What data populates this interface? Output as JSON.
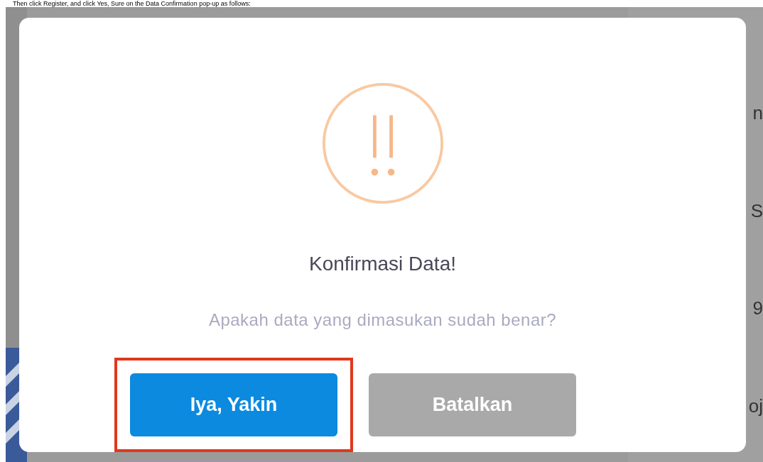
{
  "caption": "Then click Register, and click Yes, Sure on the Data Confirmation pop-up as follows:",
  "background_rows": [
    {
      "text": "n"
    },
    {
      "text": "S"
    },
    {
      "text": "9"
    },
    {
      "text": "oj"
    }
  ],
  "dialog": {
    "title": "Konfirmasi Data!",
    "message": "Apakah data yang dimasukan sudah benar?",
    "buttons": [
      {
        "label": "Iya, Yakin",
        "kind": "primary",
        "highlighted": true
      },
      {
        "label": "Batalkan",
        "kind": "secondary",
        "highlighted": false
      }
    ]
  }
}
